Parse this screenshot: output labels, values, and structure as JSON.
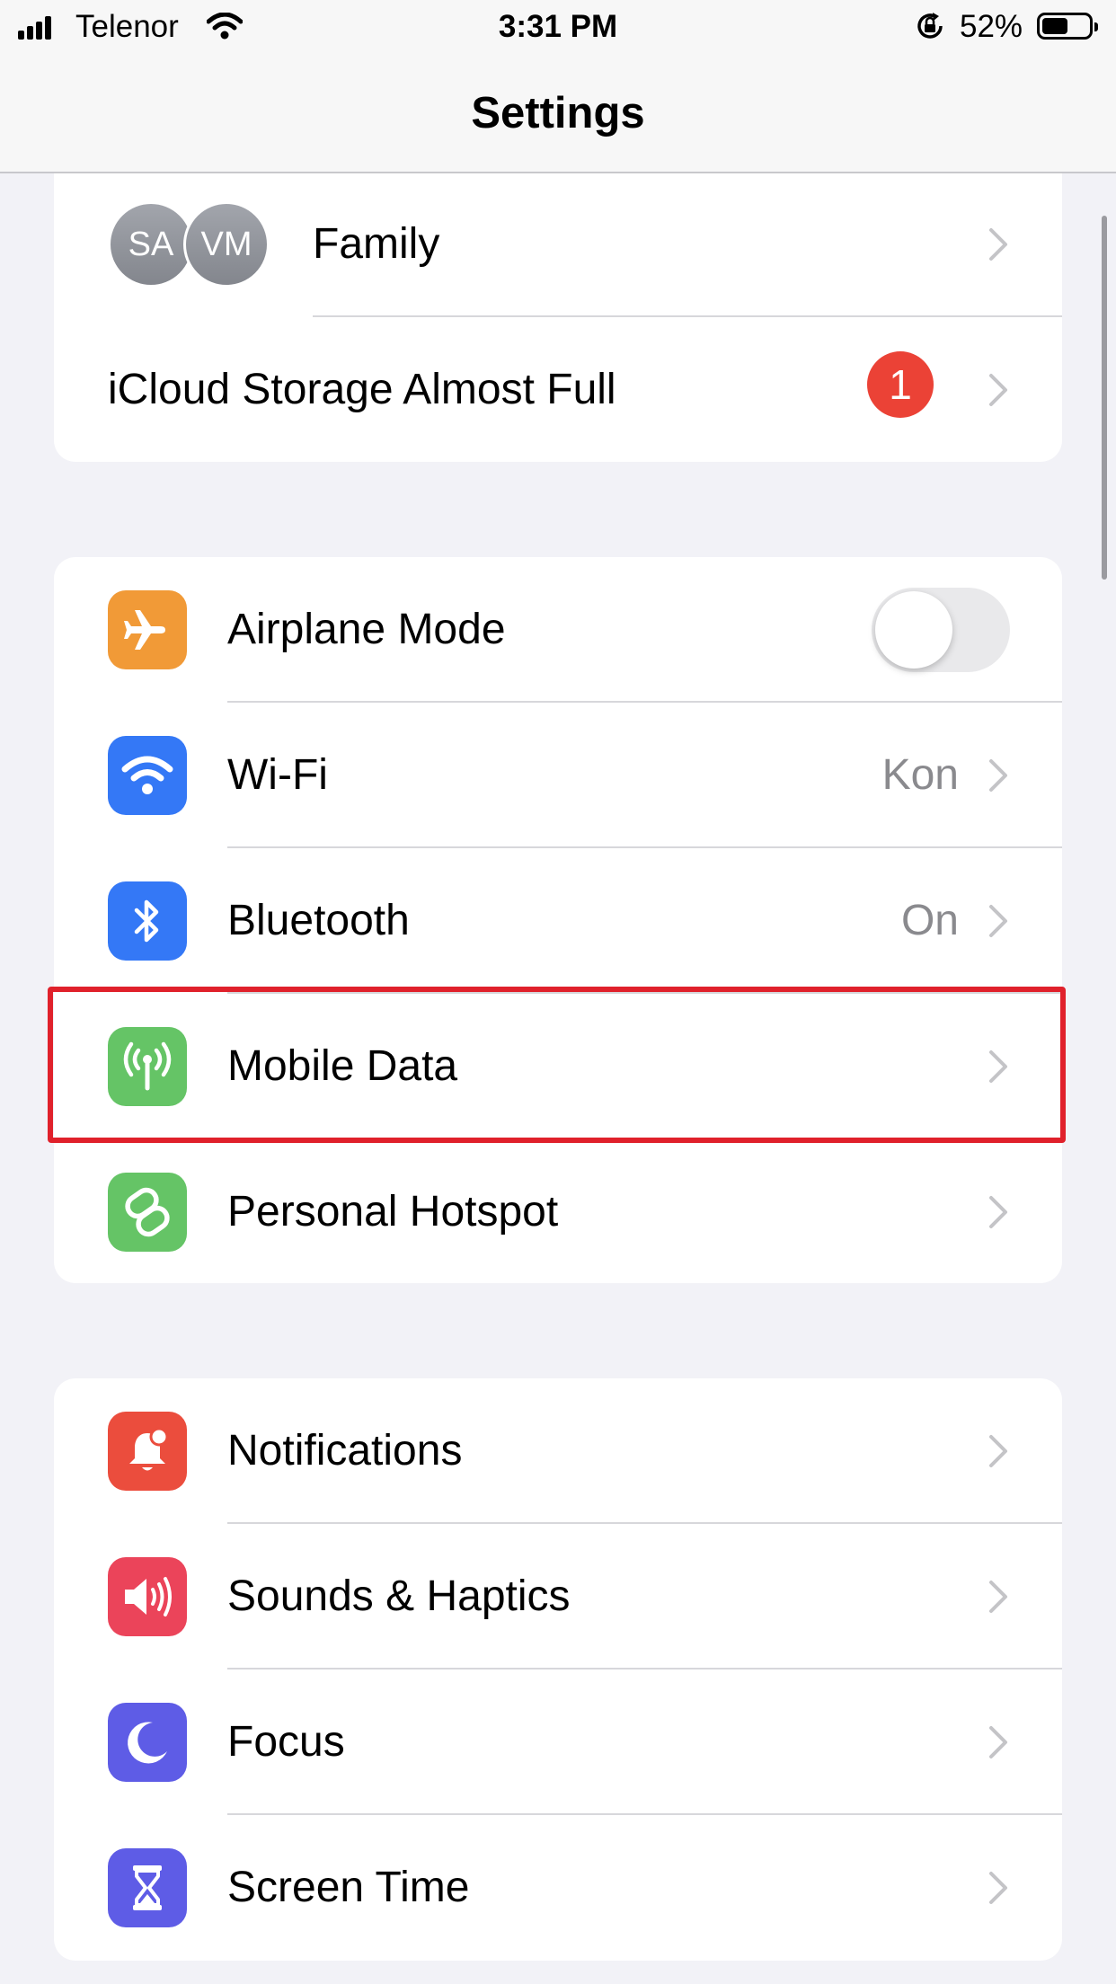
{
  "status_bar": {
    "carrier": "Telenor",
    "time": "3:31 PM",
    "battery_percent": "52%",
    "battery_level": 0.52
  },
  "nav": {
    "title": "Settings"
  },
  "account_group": {
    "family": {
      "avatars": [
        "SA",
        "VM"
      ],
      "label": "Family"
    },
    "icloud": {
      "label": "iCloud Storage Almost Full",
      "badge": "1"
    }
  },
  "connectivity_group": {
    "airplane": {
      "label": "Airplane Mode",
      "icon": "airplane-icon",
      "color": "#f19a37",
      "toggle_on": false
    },
    "wifi": {
      "label": "Wi-Fi",
      "value": "Kon",
      "icon": "wifi-icon",
      "color": "#3478f6"
    },
    "bluetooth": {
      "label": "Bluetooth",
      "value": "On",
      "icon": "bluetooth-icon",
      "color": "#3478f6"
    },
    "mobile_data": {
      "label": "Mobile Data",
      "icon": "antenna-icon",
      "color": "#65c466",
      "highlighted": true
    },
    "hotspot": {
      "label": "Personal Hotspot",
      "icon": "hotspot-link-icon",
      "color": "#65c466"
    }
  },
  "general_group": {
    "notifications": {
      "label": "Notifications",
      "icon": "bell-icon",
      "color": "#eb4d3d"
    },
    "sounds": {
      "label": "Sounds & Haptics",
      "icon": "speaker-icon",
      "color": "#eb445a"
    },
    "focus": {
      "label": "Focus",
      "icon": "moon-icon",
      "color": "#5e5ce6"
    },
    "screen_time": {
      "label": "Screen Time",
      "icon": "hourglass-icon",
      "color": "#5e5ce6"
    }
  }
}
